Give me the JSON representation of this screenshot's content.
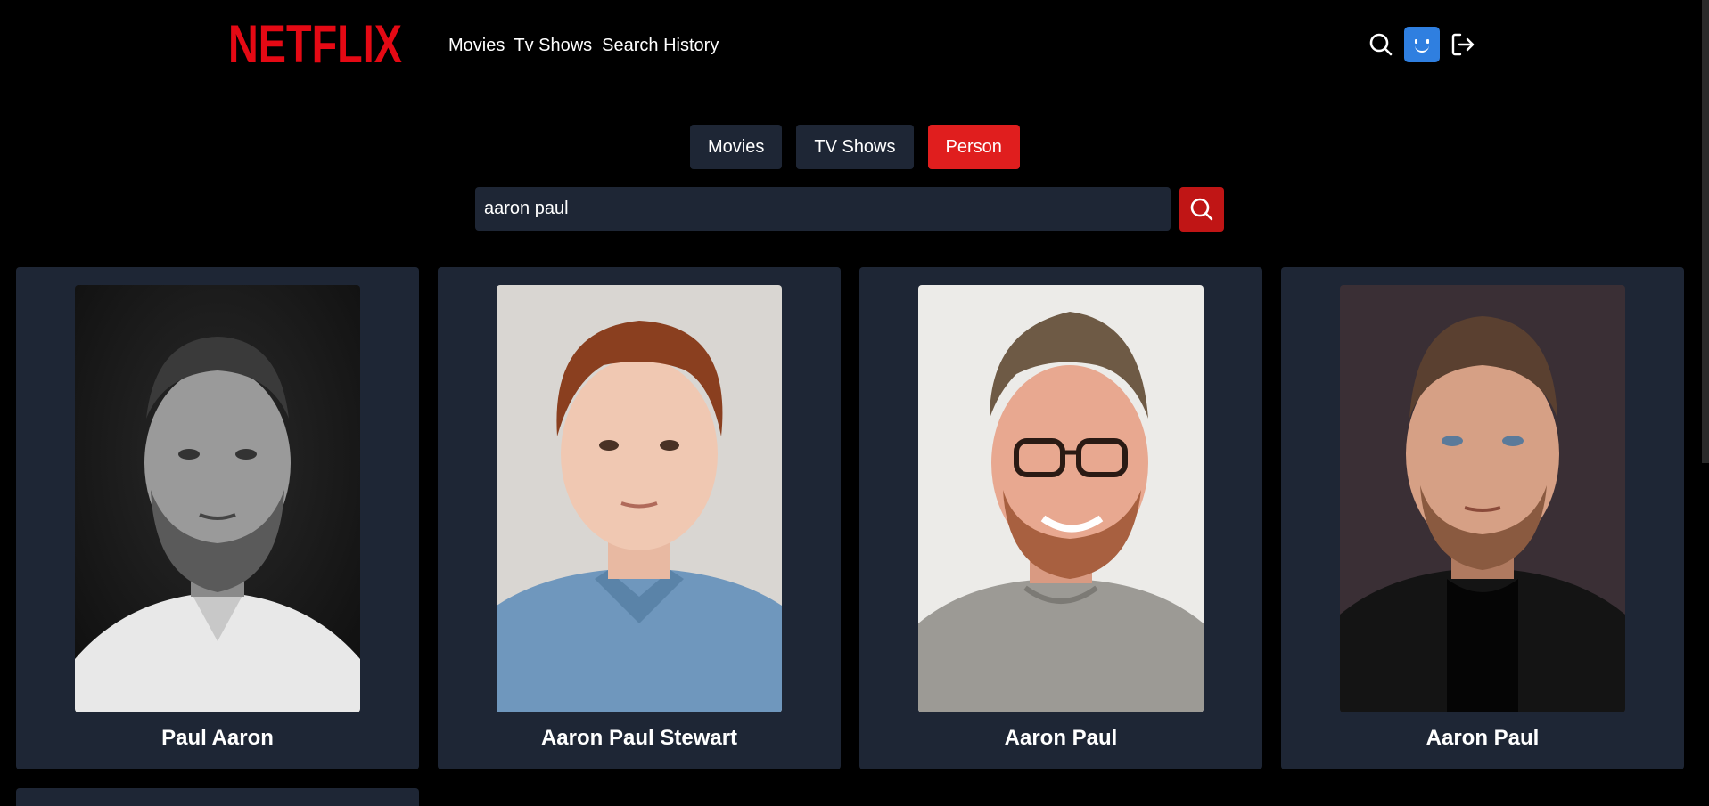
{
  "header": {
    "logo": "NETFLIX",
    "nav": [
      "Movies",
      "Tv Shows",
      "Search History"
    ]
  },
  "tabs": [
    {
      "label": "Movies",
      "active": false
    },
    {
      "label": "TV Shows",
      "active": false
    },
    {
      "label": "Person",
      "active": true
    }
  ],
  "search": {
    "value": "aaron paul"
  },
  "results": [
    {
      "name": "Paul Aaron"
    },
    {
      "name": "Aaron Paul Stewart"
    },
    {
      "name": "Aaron Paul"
    },
    {
      "name": "Aaron Paul"
    }
  ],
  "colors": {
    "brand": "#e50914",
    "active_tab": "#e01e1e",
    "card_bg": "#1e2635",
    "avatar": "#2f7fe0"
  }
}
